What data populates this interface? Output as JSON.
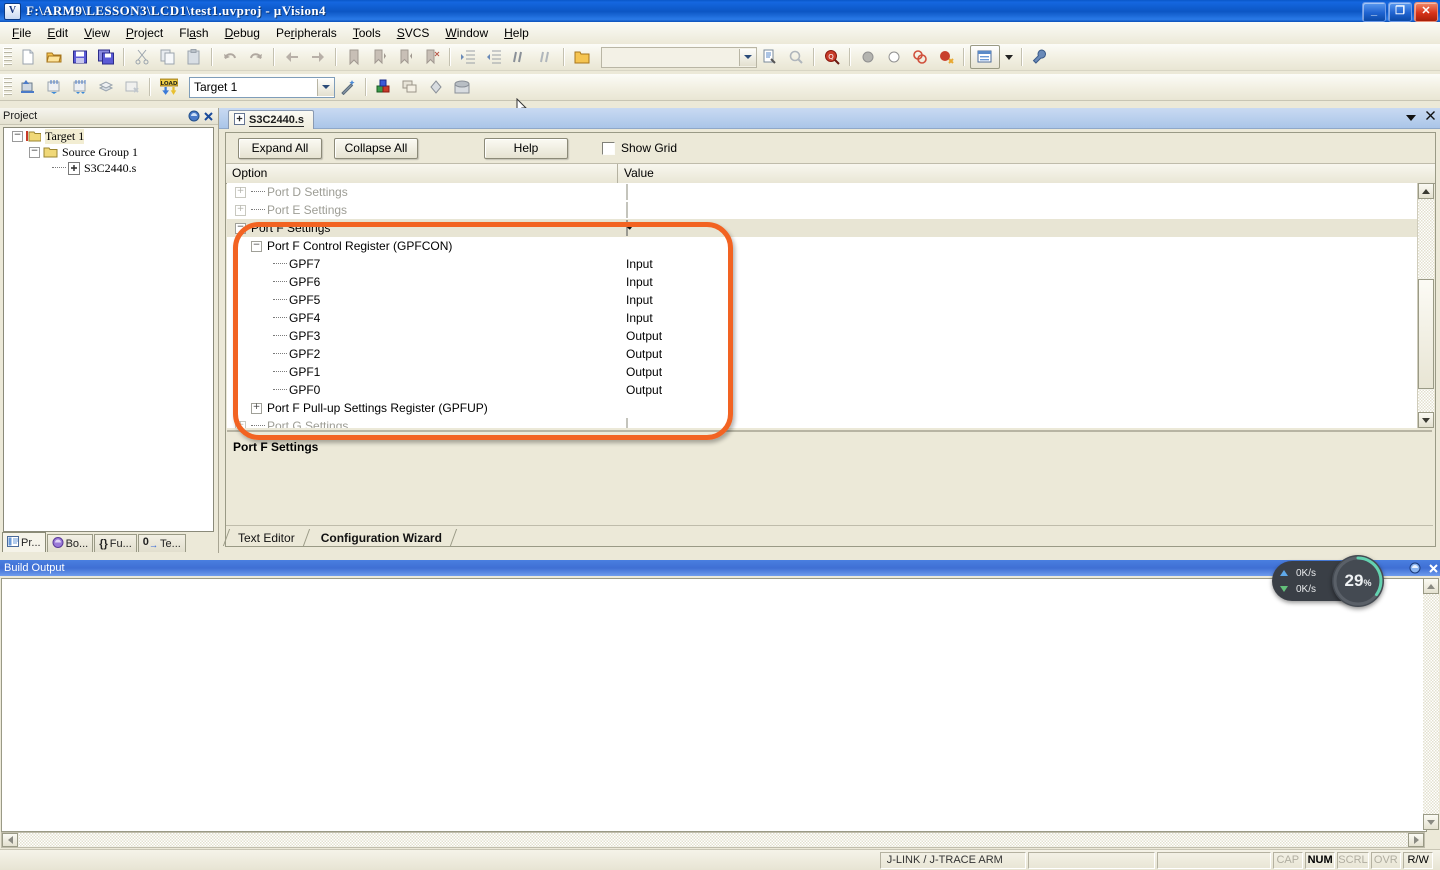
{
  "window": {
    "title": "F:\\ARM9\\LESSON3\\LCD1\\test1.uvproj - µVision4",
    "app_icon": "uvision-icon",
    "minimize_label": "–",
    "maximize_label": "❐",
    "close_label": "✕"
  },
  "menubar": {
    "items": [
      {
        "label": "File"
      },
      {
        "label": "Edit"
      },
      {
        "label": "View"
      },
      {
        "label": "Project"
      },
      {
        "label": "Flash"
      },
      {
        "label": "Debug"
      },
      {
        "label": "Peripherals"
      },
      {
        "label": "Tools"
      },
      {
        "label": "SVCS"
      },
      {
        "label": "Window"
      },
      {
        "label": "Help"
      }
    ]
  },
  "toolbar_main": {
    "buttons": [
      {
        "name": "new-file-icon",
        "tip": "New"
      },
      {
        "name": "open-file-icon",
        "tip": "Open"
      },
      {
        "name": "save-icon",
        "tip": "Save"
      },
      {
        "name": "save-all-icon",
        "tip": "Save All"
      },
      {
        "name": "cut-icon",
        "tip": "Cut"
      },
      {
        "name": "copy-icon",
        "tip": "Copy"
      },
      {
        "name": "paste-icon",
        "tip": "Paste"
      },
      {
        "name": "undo-icon",
        "tip": "Undo"
      },
      {
        "name": "redo-icon",
        "tip": "Redo"
      },
      {
        "name": "navigate-back-icon",
        "tip": "Back"
      },
      {
        "name": "navigate-forward-icon",
        "tip": "Forward"
      },
      {
        "name": "bookmark-toggle-icon",
        "tip": "Toggle Bookmark"
      },
      {
        "name": "bookmark-prev-icon",
        "tip": "Previous Bookmark"
      },
      {
        "name": "bookmark-next-icon",
        "tip": "Next Bookmark"
      },
      {
        "name": "bookmark-clear-icon",
        "tip": "Clear Bookmarks"
      },
      {
        "name": "indent-icon",
        "tip": "Indent"
      },
      {
        "name": "outdent-icon",
        "tip": "Outdent"
      },
      {
        "name": "comment-icon",
        "tip": "Comment"
      },
      {
        "name": "uncomment-icon",
        "tip": "Uncomment"
      },
      {
        "name": "open-folder-icon",
        "tip": "Open Folder"
      }
    ],
    "find_combo_value": "",
    "find_combo_placeholder": "",
    "right_buttons": [
      {
        "name": "find-in-files-icon"
      },
      {
        "name": "incremental-find-icon"
      },
      {
        "name": "magnifier-icon"
      },
      {
        "name": "breakpoint-insert-icon"
      },
      {
        "name": "breakpoint-enable-icon"
      },
      {
        "name": "breakpoint-kill-all-icon"
      },
      {
        "name": "breakpoint-disable-all-icon"
      },
      {
        "name": "window-layout-icon"
      },
      {
        "name": "configure-wrench-icon"
      }
    ]
  },
  "toolbar_build": {
    "buttons": [
      {
        "name": "translate-icon",
        "tip": "Translate"
      },
      {
        "name": "build-icon",
        "tip": "Build"
      },
      {
        "name": "rebuild-icon",
        "tip": "Rebuild"
      },
      {
        "name": "batch-build-icon",
        "tip": "Batch Build"
      },
      {
        "name": "stop-build-icon",
        "tip": "Stop Build"
      },
      {
        "name": "download-load-icon",
        "tip": "Download",
        "label": "LOAD"
      }
    ],
    "target_select_value": "Target 1",
    "after_buttons": [
      {
        "name": "target-options-magic-wand-icon"
      },
      {
        "name": "manage-components-icon"
      },
      {
        "name": "manage-multi-project-icon"
      },
      {
        "name": "manage-run-icon"
      },
      {
        "name": "manage-pack-icon"
      }
    ]
  },
  "project_panel": {
    "caption": "Project",
    "caption_icons": [
      "dock-toggle-icon",
      "close-icon"
    ],
    "tree": [
      {
        "label": "Target 1",
        "level": 0,
        "expander": "−",
        "icon": "target-folder-icon",
        "selected": true
      },
      {
        "label": "Source Group 1",
        "level": 1,
        "expander": "−",
        "icon": "group-folder-icon",
        "selected": false
      },
      {
        "label": "S3C2440.s",
        "level": 2,
        "expander": "",
        "icon": "asm-file-icon",
        "selected": false
      }
    ],
    "tabs": [
      {
        "label": "Pr...",
        "icon": "project-icon",
        "active": true
      },
      {
        "label": "Bo...",
        "icon": "books-icon",
        "active": false
      },
      {
        "label": "Fu...",
        "icon": "functions-braces-icon",
        "active": false
      },
      {
        "label": "Te...",
        "icon": "templates-icon",
        "active": false
      }
    ]
  },
  "document": {
    "tab_label": "S3C2440.s",
    "tab_icon": "asm-file-icon",
    "tabbar_right_icons": [
      "chevron-down-icon",
      "close-icon"
    ]
  },
  "wizard": {
    "buttons": {
      "expand_all": "Expand All",
      "collapse_all": "Collapse All",
      "help": "Help"
    },
    "show_grid": {
      "label": "Show Grid",
      "checked": false
    },
    "headers": {
      "option": "Option",
      "value": "Value"
    },
    "rows": [
      {
        "label": "Port D Settings",
        "indent": 0,
        "expander": "+",
        "value_type": "checkbox",
        "checked": false,
        "dim": true,
        "highlight": false
      },
      {
        "label": "Port E Settings",
        "indent": 0,
        "expander": "+",
        "value_type": "checkbox",
        "checked": false,
        "dim": true,
        "highlight": false
      },
      {
        "label": "Port F Settings",
        "indent": 0,
        "expander": "−",
        "value_type": "checkbox",
        "checked": true,
        "dim": false,
        "highlight": true
      },
      {
        "label": "Port F Control Register (GPFCON)",
        "indent": 1,
        "expander": "−",
        "value_type": "none",
        "value": "",
        "dim": false,
        "highlight": false
      },
      {
        "label": "GPF7",
        "indent": 2,
        "expander": "leaf",
        "value_type": "text",
        "value": "Input",
        "dim": false,
        "highlight": false
      },
      {
        "label": "GPF6",
        "indent": 2,
        "expander": "leaf",
        "value_type": "text",
        "value": "Input",
        "dim": false,
        "highlight": false
      },
      {
        "label": "GPF5",
        "indent": 2,
        "expander": "leaf",
        "value_type": "text",
        "value": "Input",
        "dim": false,
        "highlight": false
      },
      {
        "label": "GPF4",
        "indent": 2,
        "expander": "leaf",
        "value_type": "text",
        "value": "Input",
        "dim": false,
        "highlight": false
      },
      {
        "label": "GPF3",
        "indent": 2,
        "expander": "leaf",
        "value_type": "text",
        "value": "Output",
        "dim": false,
        "highlight": false
      },
      {
        "label": "GPF2",
        "indent": 2,
        "expander": "leaf",
        "value_type": "text",
        "value": "Output",
        "dim": false,
        "highlight": false
      },
      {
        "label": "GPF1",
        "indent": 2,
        "expander": "leaf",
        "value_type": "text",
        "value": "Output",
        "dim": false,
        "highlight": false
      },
      {
        "label": "GPF0",
        "indent": 2,
        "expander": "leaf",
        "value_type": "text",
        "value": "Output",
        "dim": false,
        "highlight": false
      },
      {
        "label": "Port F Pull-up Settings Register (GPFUP)",
        "indent": 1,
        "expander": "+",
        "value_type": "none",
        "value": "",
        "dim": false,
        "highlight": false
      },
      {
        "label": "Port G Settings",
        "indent": 0,
        "expander": "+",
        "value_type": "checkbox",
        "checked": false,
        "dim": true,
        "highlight": false
      }
    ],
    "description": "Port F Settings",
    "tabs": [
      {
        "label": "Text Editor",
        "active": false
      },
      {
        "label": "Configuration Wizard",
        "active": true
      }
    ]
  },
  "build_output": {
    "caption": "Build Output",
    "caption_icons": [
      "dock-toggle-icon",
      "close-icon"
    ],
    "content": ""
  },
  "net_monitor": {
    "upload": "0K/s",
    "download": "0K/s",
    "percent_value": "29",
    "percent_unit": "%",
    "ring_color": "#5fd0b0"
  },
  "statusbar": {
    "debugger": "J-LINK / J-TRACE ARM",
    "flags": [
      {
        "label": "CAP",
        "active": false
      },
      {
        "label": "NUM",
        "active": true
      },
      {
        "label": "SCRL",
        "active": false
      },
      {
        "label": "OVR",
        "active": false
      },
      {
        "label": "R/W",
        "active": false
      }
    ]
  },
  "annotation": {
    "color": "#f26322",
    "shape": "rounded-rect-highlight"
  }
}
